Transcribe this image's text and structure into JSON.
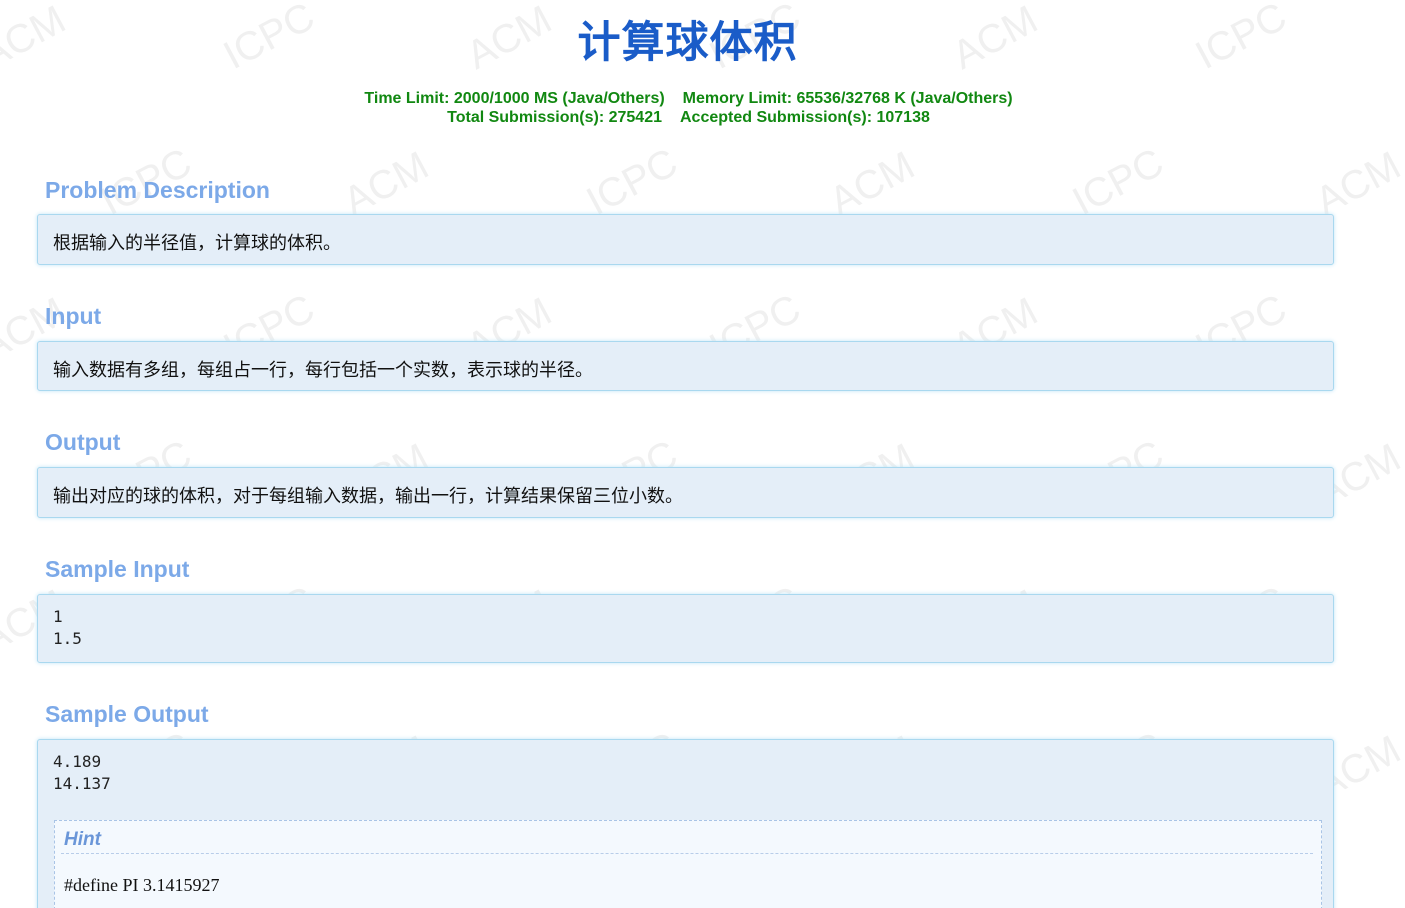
{
  "problem": {
    "title": "计算球体积",
    "limits": {
      "time_limit": "Time Limit: 2000/1000 MS (Java/Others)",
      "memory_limit": "Memory Limit: 65536/32768 K (Java/Others)",
      "total_submissions": "Total Submission(s): 275421",
      "accepted_submissions": "Accepted Submission(s): 107138"
    },
    "sections": {
      "description": {
        "heading": "Problem Description",
        "text": "根据输入的半径值，计算球的体积。"
      },
      "input": {
        "heading": "Input",
        "text": "输入数据有多组，每组占一行，每行包括一个实数，表示球的半径。"
      },
      "output": {
        "heading": "Output",
        "text": "输出对应的球的体积，对于每组输入数据，输出一行，计算结果保留三位小数。"
      },
      "sample_input": {
        "heading": "Sample Input",
        "text": "1\n1.5"
      },
      "sample_output": {
        "heading": "Sample Output",
        "text": "4.189\n14.137"
      },
      "hint": {
        "heading": "Hint",
        "text": "#define PI 3.1415927"
      }
    }
  },
  "watermark": {
    "words": [
      "ACM",
      "ICPC"
    ],
    "color": "#f0f0f0"
  },
  "colors": {
    "title": "#1a5cc8",
    "limits": "#118811",
    "section_heading": "#7ca9e8",
    "panel_bg": "#e4eef8",
    "panel_border": "#a9d8ef"
  }
}
